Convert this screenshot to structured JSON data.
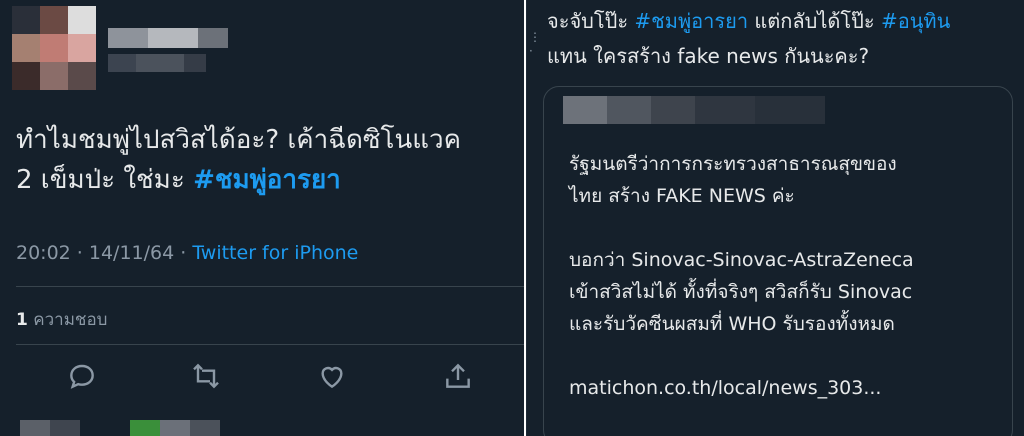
{
  "left_tweet": {
    "text_line1": "ทำไมชมพู่ไปสวิสได้อะ? เค้าฉีดซิโนแวค",
    "text_line2": "2 เข็มป่ะ  ใช่มะ ",
    "hashtag": "#ชมพู่อารยา",
    "timestamp": "20:02 · 14/11/64 · ",
    "source": "Twitter for iPhone",
    "likes_count": "1",
    "likes_label": " ความชอบ",
    "actions": [
      "reply-icon",
      "retweet-icon",
      "like-icon",
      "share-icon"
    ]
  },
  "right_tweet": {
    "line1_pre": "จะจับโป๊ะ ",
    "line1_tag1": "#ชมพู่อารยา",
    "line1_mid": " แต่กลับได้โป๊ะ ",
    "line1_tag2": "#อนุทิน",
    "line2": "แทน ใครสร้าง fake news กันนะคะ?",
    "quoted": {
      "p1_line1": "รัฐมนตรีว่าการกระทรวงสาธารณสุขของ",
      "p1_line2": "ไทย สร้าง FAKE NEWS ค่ะ",
      "p2_line1": "บอกว่า Sinovac-Sinovac-AstraZeneca",
      "p2_line2": "เข้าสวิสไม่ได้  ทั้งที่จริงๆ สวิสก็รับ Sinovac",
      "p2_line3": "และรับวัคซีนผสมที่ WHO รับรองทั้งหมด",
      "link": "matichon.co.th/local/news_303..."
    }
  },
  "colors": {
    "background": "#15202b",
    "text": "#e7e9ea",
    "muted": "#8b98a5",
    "accent": "#1d9bf0",
    "border": "#38444d"
  }
}
